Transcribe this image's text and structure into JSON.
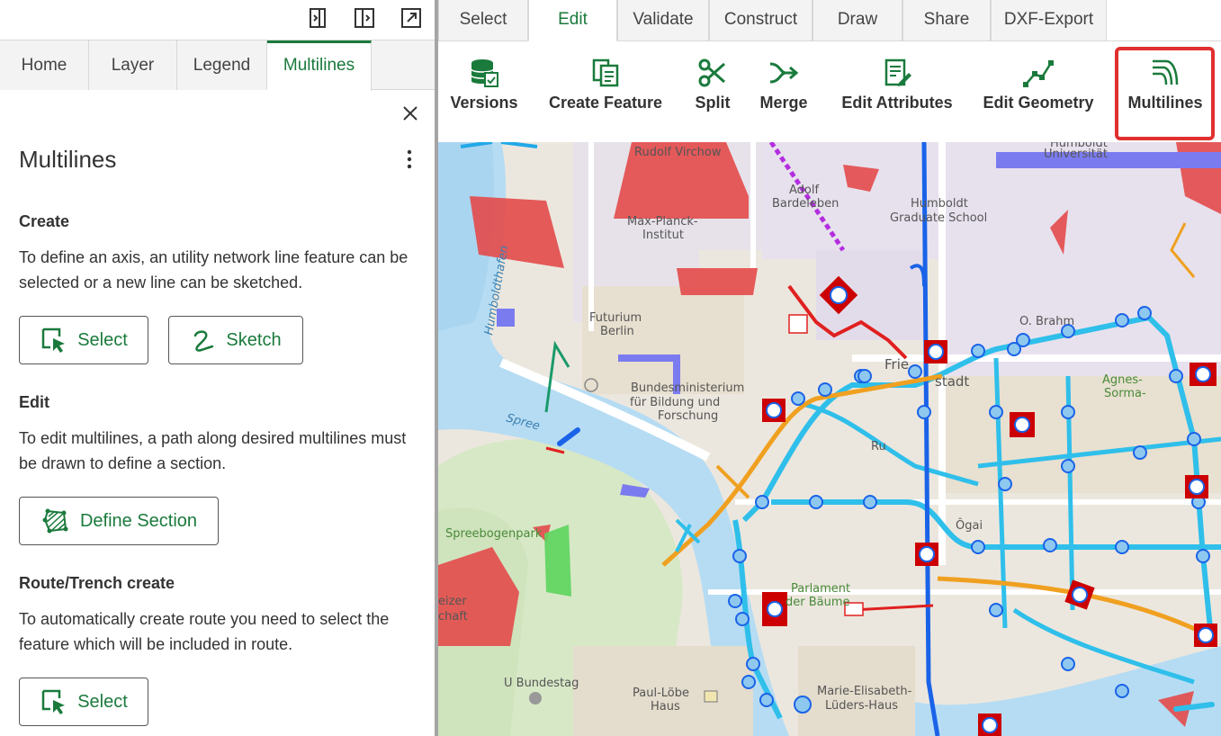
{
  "left_panel": {
    "toolbar_icons": [
      "dock-left-icon",
      "split-view-icon",
      "pop-out-icon"
    ],
    "tabs": [
      {
        "label": "Home",
        "active": false
      },
      {
        "label": "Layer",
        "active": false
      },
      {
        "label": "Legend",
        "active": false
      },
      {
        "label": "Multilines",
        "active": true
      }
    ],
    "title": "Multilines",
    "sections": {
      "create": {
        "heading": "Create",
        "text": "To define an axis, an utility network line feature can be selected or a new line can be sketched.",
        "select_label": "Select",
        "sketch_label": "Sketch"
      },
      "edit": {
        "heading": "Edit",
        "text": "To edit multilines, a path along desired multilines must be drawn to define a section.",
        "define_section_label": "Define Section"
      },
      "route": {
        "heading": "Route/Trench create",
        "text": "To automatically create route you need to select the feature which will be included in route.",
        "select_label": "Select"
      }
    }
  },
  "ribbon": {
    "tabs": [
      {
        "label": "Select",
        "active": false
      },
      {
        "label": "Edit",
        "active": true
      },
      {
        "label": "Validate",
        "active": false
      },
      {
        "label": "Construct",
        "active": false
      },
      {
        "label": "Draw",
        "active": false
      },
      {
        "label": "Share",
        "active": false
      },
      {
        "label": "DXF-Export",
        "active": false
      }
    ],
    "buttons": {
      "versions": "Versions",
      "create_feature": "Create Feature",
      "split": "Split",
      "merge": "Merge",
      "edit_attributes": "Edit Attributes",
      "edit_geometry": "Edit Geometry",
      "multilines": "Multilines"
    },
    "highlighted": "multilines",
    "accent_color": "#1a7a3c",
    "highlight_color": "#e03030"
  },
  "map": {
    "labels": {
      "virchow": "Rudolf Virchow",
      "bardeleben_1": "Adolf",
      "bardeleben_2": "Bardeleben",
      "humboldt_uni_1": "Humboldt",
      "humboldt_uni_2": "Universität",
      "humboldt_grad_1": "Humboldt",
      "humboldt_grad_2": "Graduate School",
      "max_planck_1": "Max-Planck-",
      "max_planck_2": "Institut",
      "futurium_1": "Futurium",
      "futurium_2": "Berlin",
      "bmbf_1": "Bundesministerium",
      "bmbf_2": "für Bildung und",
      "bmbf_3": "Forschung",
      "spree": "Spree",
      "humboldthafen": "Humboldthafen",
      "spreebogenpark": "Spreebogenpark",
      "parlament_1": "Parlament",
      "parlament_2": "der Bäume",
      "agnes_1": "Agnes-",
      "agnes_2": "Sorma-",
      "friedrichstadt_1": "Frie",
      "friedrichstadt_2": "stadt",
      "o_brahm": "O. Brahm",
      "u_bundestag": "U Bundestag",
      "paul_loebe_1": "Paul-Löbe",
      "paul_loebe_2": "Haus",
      "me_lueders_1": "Marie-Elisabeth-",
      "me_lueders_2": "Lüders-Haus",
      "schweizer_1": "eizer",
      "schweizer_2": "chaft",
      "ogai": "Ôgai",
      "rue": "Ru"
    }
  }
}
